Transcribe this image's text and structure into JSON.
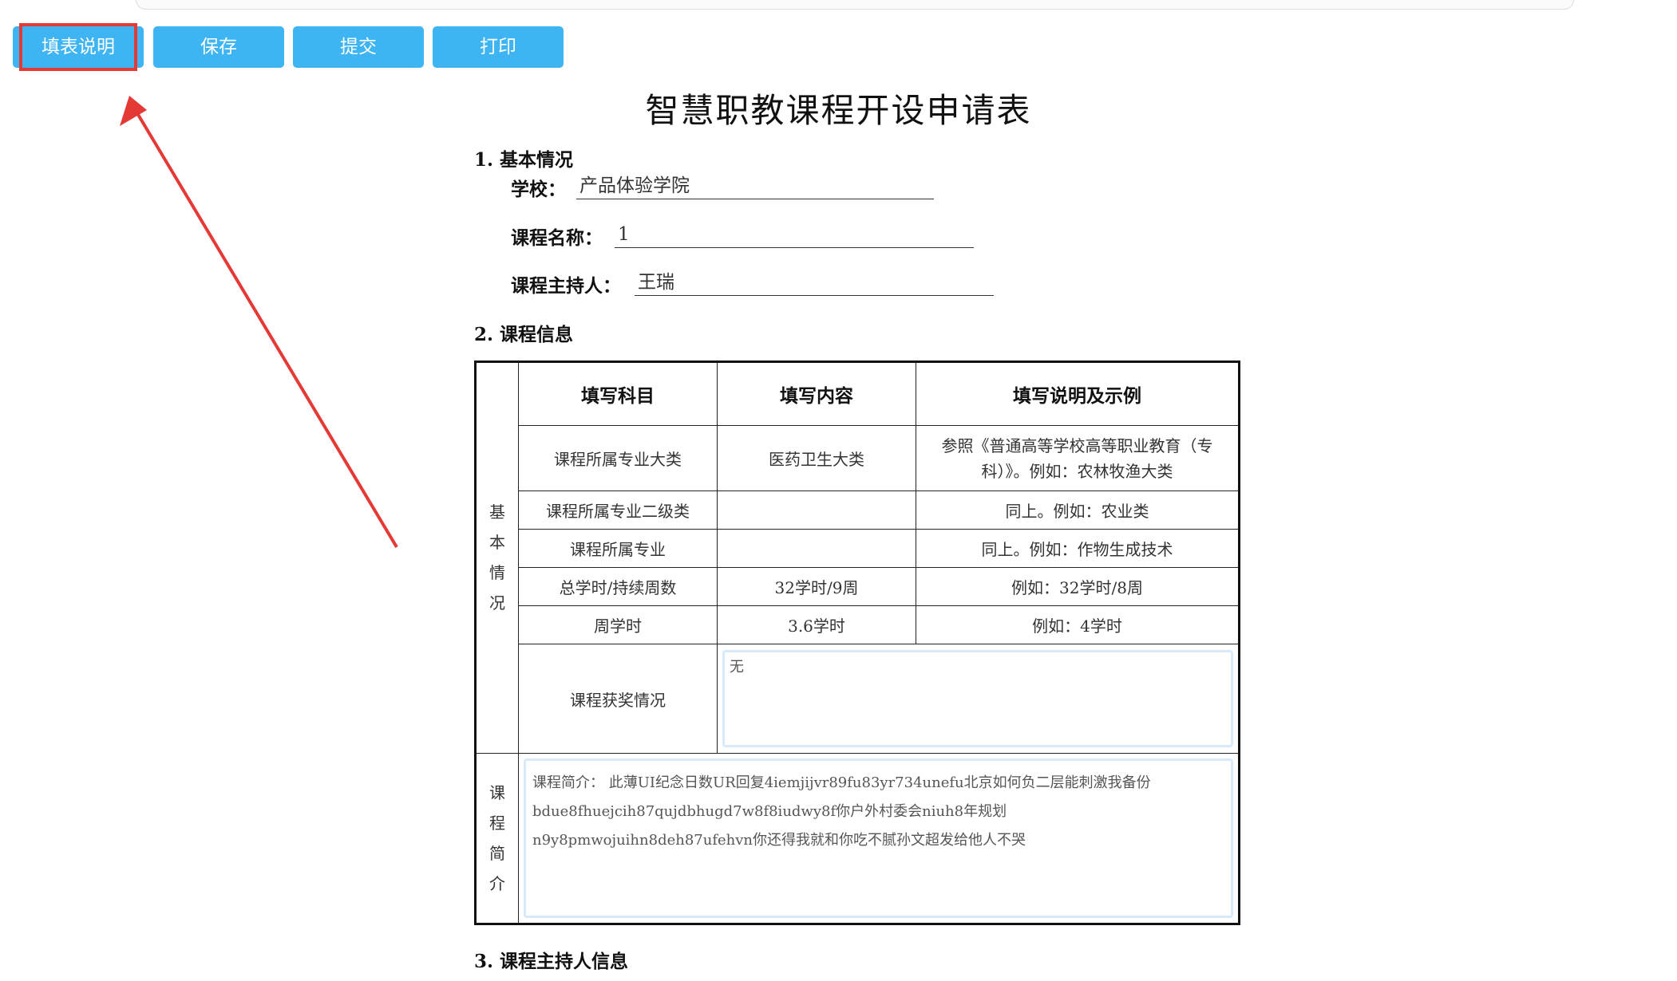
{
  "toolbar": {
    "buttons": [
      "填表说明",
      "保存",
      "提交",
      "打印"
    ]
  },
  "title": "智慧职教课程开设申请表",
  "section1": {
    "heading": "1. 基本情况",
    "fields": [
      {
        "label": "学校：",
        "value": "产品体验学院"
      },
      {
        "label": "课程名称：",
        "value": "1"
      },
      {
        "label": "课程主持人：",
        "value": "王瑞"
      }
    ]
  },
  "section2": {
    "heading": "2. 课程信息",
    "table": {
      "group_basic": "基本情况",
      "group_intro": "课程简介",
      "headers": [
        "填写科目",
        "填写内容",
        "填写说明及示例"
      ],
      "rows": [
        {
          "subject": "课程所属专业大类",
          "content": "医药卫生大类",
          "note": "参照《普通高等学校高等职业教育（专科）》。例如：农林牧渔大类"
        },
        {
          "subject": "课程所属专业二级类",
          "content": "",
          "note": "同上。例如：农业类"
        },
        {
          "subject": "课程所属专业",
          "content": "",
          "note": "同上。例如：作物生成技术"
        },
        {
          "subject": "总学时/持续周数",
          "content": "32学时/9周",
          "note": "例如：32学时/8周"
        },
        {
          "subject": "周学时",
          "content": "3.6学时",
          "note": "例如：4学时"
        }
      ],
      "award_label": "课程获奖情况",
      "award_value": "无",
      "intro_value": "课程简介： 此薄UI纪念日数UR回复4iemjijvr89fu83yr734unefu北京如何负二层能刺激我备份bdue8fhuejcih87qujdbhugd7w8f8iudwy8f你户外村委会niuh8年规划n9y8pmwojuihn8deh87ufehvn你还得我就和你吃不腻孙文超发给他人不哭"
    }
  },
  "section3": {
    "heading": "3. 课程主持人信息"
  },
  "colors": {
    "button": "#3fb4f2",
    "highlight": "#e53935"
  }
}
